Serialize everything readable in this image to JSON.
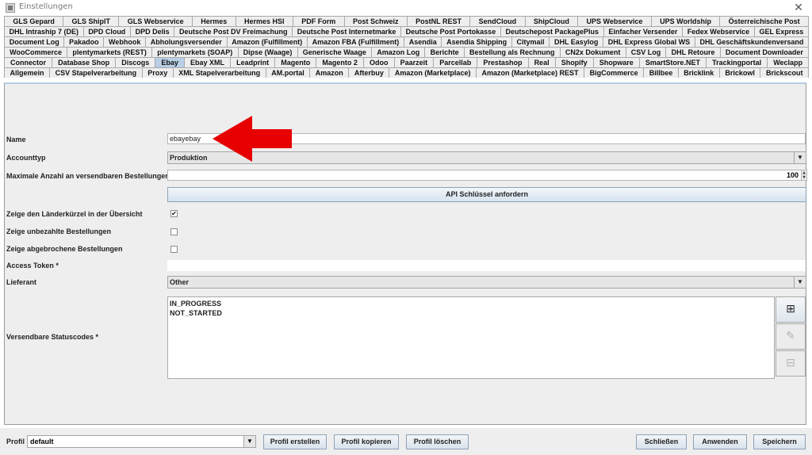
{
  "window": {
    "title": "Einstellungen",
    "close_glyph": "✕"
  },
  "tabs": {
    "rows": [
      [
        "GLS Gepard",
        "GLS ShipIT",
        "GLS Webservice",
        "Hermes",
        "Hermes HSI",
        "PDF Form",
        "Post Schweiz",
        "PostNL REST",
        "SendCloud",
        "ShipCloud",
        "UPS Webservice",
        "UPS Worldship",
        "Österreichische Post"
      ],
      [
        "DHL Intraship 7 (DE)",
        "DPD Cloud",
        "DPD Delis",
        "Deutsche Post DV Freimachung",
        "Deutsche Post Internetmarke",
        "Deutsche Post Portokasse",
        "Deutschepost PackagePlus",
        "Einfacher Versender",
        "Fedex Webservice",
        "GEL Express"
      ],
      [
        "Document Log",
        "Pakadoo",
        "Webhook",
        "Abholungsversender",
        "Amazon (Fulfillment)",
        "Amazon FBA (Fulfillment)",
        "Asendia",
        "Asendia Shipping",
        "Citymail",
        "DHL Easylog",
        "DHL Express Global WS",
        "DHL Geschäftskundenversand"
      ],
      [
        "WooCommerce",
        "plentymarkets (REST)",
        "plentymarkets (SOAP)",
        "Dipse (Waage)",
        "Generische Waage",
        "Amazon Log",
        "Berichte",
        "Bestellung als Rechnung",
        "CN2x Dokument",
        "CSV Log",
        "DHL Retoure",
        "Document Downloader"
      ],
      [
        "Connector",
        "Database Shop",
        "Discogs",
        "Ebay",
        "Ebay XML",
        "Leadprint",
        "Magento",
        "Magento 2",
        "Odoo",
        "Paarzeit",
        "Parcellab",
        "Prestashop",
        "Real",
        "Shopify",
        "Shopware",
        "SmartStore.NET",
        "Trackingportal",
        "Weclapp"
      ],
      [
        "Allgemein",
        "CSV Stapelverarbeitung",
        "Proxy",
        "XML Stapelverarbeitung",
        "AM.portal",
        "Amazon",
        "Afterbuy",
        "Amazon (Marketplace)",
        "Amazon (Marketplace) REST",
        "BigCommerce",
        "Billbee",
        "Bricklink",
        "Brickowl",
        "Brickscout"
      ]
    ],
    "selected": "Ebay"
  },
  "form": {
    "name_label": "Name",
    "name_value": "ebayebay",
    "accounttyp_label": "Accounttyp",
    "accounttyp_value": "Produktion",
    "max_label": "Maximale Anzahl an versendbaren Bestellungen",
    "max_value": "100",
    "api_button": "API Schlüssel anfordern",
    "laender_label": "Zeige den Länderkürzel in der Übersicht",
    "laender_checked": true,
    "unbezahlt_label": "Zeige unbezahlte Bestellungen",
    "unbezahlt_checked": false,
    "abgebrochen_label": "Zeige abgebrochene Bestellungen",
    "abgebrochen_checked": false,
    "token_label": "Access Token *",
    "token_value": "",
    "lieferant_label": "Lieferant",
    "lieferant_value": "Other",
    "status_label": "Versendbare Statuscodes *",
    "status_items": [
      "IN_PROGRESS",
      "NOT_STARTED"
    ]
  },
  "icons": {
    "add": "plus-box-icon",
    "edit": "edit-icon",
    "remove": "minus-box-icon",
    "arrow": "red-arrow-annotation",
    "arrow_color": "#e60000"
  },
  "footer": {
    "profil_label": "Profil",
    "profil_value": "default",
    "erstellen": "Profil erstellen",
    "kopieren": "Profil kopieren",
    "loeschen": "Profil löschen",
    "schliessen": "Schließen",
    "anwenden": "Anwenden",
    "speichern": "Speichern"
  }
}
